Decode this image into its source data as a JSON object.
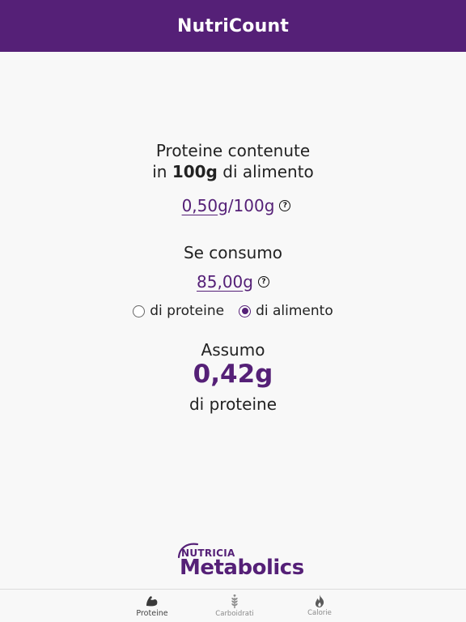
{
  "header": {
    "title": "NutriCount"
  },
  "main": {
    "intro_line1": "Proteine contenute",
    "intro_line2_prefix": "in ",
    "intro_line2_bold": "100g",
    "intro_line2_suffix": " di alimento",
    "protein_per_100g": {
      "value": "0,50",
      "unit": "g/100g",
      "help_glyph": "?"
    },
    "consume_label": "Se consumo",
    "consume": {
      "value": "85,00",
      "unit": "g",
      "help_glyph": "?"
    },
    "mode_options": [
      {
        "label": "di proteine",
        "selected": false
      },
      {
        "label": "di alimento",
        "selected": true
      }
    ],
    "result_label": "Assumo",
    "result_value": "0,42g",
    "result_suffix": "di proteine"
  },
  "logo": {
    "brand": "NUTRICIA",
    "name": "Metabolics"
  },
  "tabbar": {
    "tabs": [
      {
        "label": "Proteine",
        "icon": "bicep-icon",
        "active": true
      },
      {
        "label": "Carboidrati",
        "icon": "wheat-icon",
        "active": false
      },
      {
        "label": "Calorie",
        "icon": "flame-icon",
        "active": false
      }
    ]
  },
  "colors": {
    "brand_purple": "#552077",
    "background": "#f8f8f8"
  }
}
